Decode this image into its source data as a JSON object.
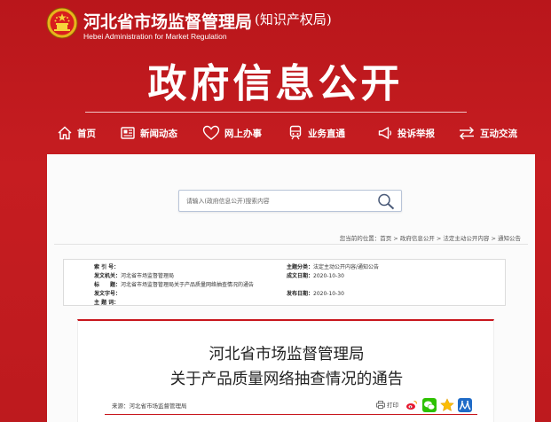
{
  "header": {
    "agency_name": "河北省市场监督管理局",
    "agency_sub": "(知识产权局)",
    "agency_en": "Hebei Administration for Market Regulation",
    "section_title": "政府信息公开"
  },
  "nav": {
    "items": [
      {
        "label": "首页",
        "icon": "home-icon"
      },
      {
        "label": "新闻动态",
        "icon": "news-icon"
      },
      {
        "label": "网上办事",
        "icon": "heart-icon"
      },
      {
        "label": "业务直通",
        "icon": "train-icon"
      },
      {
        "label": "投诉举报",
        "icon": "megaphone-icon"
      },
      {
        "label": "互动交流",
        "icon": "exchange-icon"
      }
    ]
  },
  "search": {
    "placeholder": "请输入(政府信息公开)搜索内容",
    "icon": "search-icon"
  },
  "breadcrumb": {
    "prefix": "您当前的位置：",
    "items": [
      "首页",
      "政府信息公开",
      "法定主动公开内容",
      "通知公告"
    ],
    "separator": " > "
  },
  "meta": {
    "index_label": "索 引 号：",
    "index_value": "",
    "issuer_label": "发文机关：",
    "issuer_value": "河北省市场监督管理局",
    "title_label": "标　　题：",
    "title_value": "河北省市场监督管理局关于产品质量网络抽查情况的通告",
    "doc_no_label": "发文字号：",
    "doc_no_value": "",
    "topic_label": "主 题 词：",
    "topic_value": "",
    "category_label": "主题分类：",
    "category_value": "法定主动公开内容/通知公告",
    "written_label": "成文日期：",
    "written_value": "2020-10-30",
    "published_label": "发布日期：",
    "published_value": "2020-10-30"
  },
  "document": {
    "title_line1": "河北省市场监督管理局",
    "title_line2": "关于产品质量网络抽查情况的通告",
    "source": "来源：河北省市场监督管理局",
    "print_label": "打印"
  },
  "share": {
    "icons": [
      "weibo-icon",
      "wechat-icon",
      "qzone-icon",
      "renren-icon"
    ]
  },
  "colors": {
    "brand_red": "#c61d21",
    "panel_bg": "#fbfbfb",
    "accent_line": "#c8161d"
  }
}
